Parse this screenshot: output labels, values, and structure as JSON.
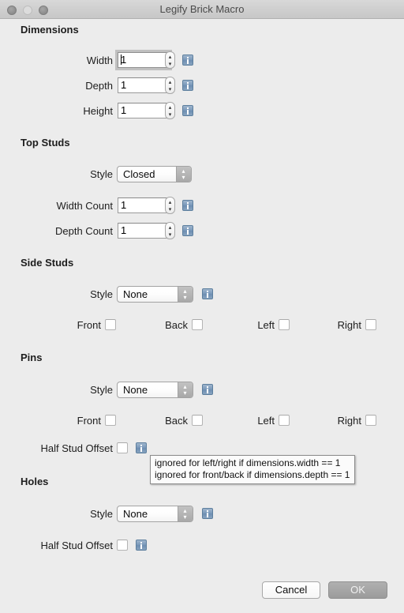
{
  "window": {
    "title": "Legify Brick Macro",
    "traffic_lights": [
      "close",
      "minimize",
      "zoom"
    ]
  },
  "sections": {
    "dimensions": {
      "header": "Dimensions",
      "rows": [
        {
          "label": "Width",
          "value": "1"
        },
        {
          "label": "Depth",
          "value": "1"
        },
        {
          "label": "Height",
          "value": "1"
        }
      ]
    },
    "top_studs": {
      "header": "Top Studs",
      "style_label": "Style",
      "style_value": "Closed",
      "rows": [
        {
          "label": "Width Count",
          "value": "1"
        },
        {
          "label": "Depth Count",
          "value": "1"
        }
      ]
    },
    "side_studs": {
      "header": "Side Studs",
      "style_label": "Style",
      "style_value": "None",
      "checkboxes": [
        {
          "label": "Front",
          "checked": false
        },
        {
          "label": "Back",
          "checked": false
        },
        {
          "label": "Left",
          "checked": false
        },
        {
          "label": "Right",
          "checked": false
        }
      ]
    },
    "pins": {
      "header": "Pins",
      "style_label": "Style",
      "style_value": "None",
      "checkboxes": [
        {
          "label": "Front",
          "checked": false
        },
        {
          "label": "Back",
          "checked": false
        },
        {
          "label": "Left",
          "checked": false
        },
        {
          "label": "Right",
          "checked": false
        }
      ],
      "half_stud_offset_label": "Half Stud Offset"
    },
    "holes": {
      "header": "Holes",
      "style_label": "Style",
      "style_value": "None",
      "half_stud_offset_label": "Half Stud Offset"
    }
  },
  "tooltip": {
    "line1": "ignored for left/right if dimensions.width == 1",
    "line2": "ignored for front/back if dimensions.depth == 1"
  },
  "buttons": {
    "cancel": "Cancel",
    "ok": "OK"
  },
  "icons": {
    "info": "info-icon",
    "stepper_up": "▴",
    "stepper_down": "▾",
    "popup_up": "▴",
    "popup_down": "▾"
  },
  "colors": {
    "window_bg": "#ececec",
    "titlebar_top": "#d8d8d8",
    "titlebar_bottom": "#c7c7c7",
    "info_icon": "#7c9bbb",
    "default_button": "#a5a5a5",
    "text": "#1d1d1d"
  }
}
